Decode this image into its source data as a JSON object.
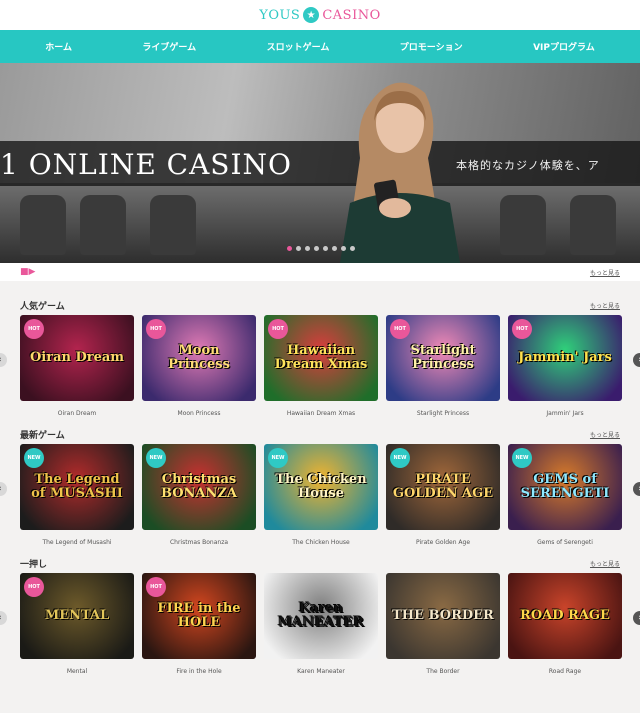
{
  "logo": {
    "left": "YOUS",
    "right": "CASINO",
    "star": "★"
  },
  "nav": [
    "ホーム",
    "ライブゲーム",
    "スロットゲーム",
    "プロモーション",
    "VIPプログラム"
  ],
  "hero": {
    "title": "1 ONLINE CASINO",
    "tagline": "本格的なカジノ体験を、ア"
  },
  "audio_bar": {
    "more": "もっと見る"
  },
  "sections": [
    {
      "heading": "人気ゲーム",
      "more": "もっと見る",
      "games": [
        {
          "name": "Oiran Dream",
          "art": "Oiran Dream",
          "badge": "HOT"
        },
        {
          "name": "Moon Princess",
          "art": "Moon Princess",
          "badge": "HOT"
        },
        {
          "name": "Hawaiian Dream Xmas",
          "art": "Hawaiian Dream Xmas",
          "badge": "HOT"
        },
        {
          "name": "Starlight Princess",
          "art": "Starlight Princess",
          "badge": "HOT"
        },
        {
          "name": "Jammin' Jars",
          "art": "Jammin' Jars",
          "badge": "HOT"
        }
      ]
    },
    {
      "heading": "最新ゲーム",
      "more": "もっと見る",
      "games": [
        {
          "name": "The Legend of Musashi",
          "art": "The Legend of MUSASHI",
          "badge": "NEW"
        },
        {
          "name": "Christmas Bonanza",
          "art": "Christmas BONANZA",
          "badge": "NEW"
        },
        {
          "name": "The Chicken House",
          "art": "The Chicken House",
          "badge": "NEW"
        },
        {
          "name": "Pirate Golden Age",
          "art": "PIRATE GOLDEN AGE",
          "badge": "NEW"
        },
        {
          "name": "Gems of Serengeti",
          "art": "GEMS of SERENGETI",
          "badge": "NEW"
        }
      ]
    },
    {
      "heading": "一押し",
      "more": "もっと見る",
      "games": [
        {
          "name": "Mental",
          "art": "MENTAL",
          "badge": "HOT"
        },
        {
          "name": "Fire in the Hole",
          "art": "FIRE in the HOLE",
          "badge": "HOT"
        },
        {
          "name": "Karen Maneater",
          "art": "Karen MANEATER",
          "badge": ""
        },
        {
          "name": "The Border",
          "art": "THE BORDER",
          "badge": ""
        },
        {
          "name": "Road Rage",
          "art": "ROAD RAGE",
          "badge": ""
        }
      ]
    }
  ],
  "colors": {
    "teal": "#27c7c2",
    "pink": "#e9579a"
  }
}
